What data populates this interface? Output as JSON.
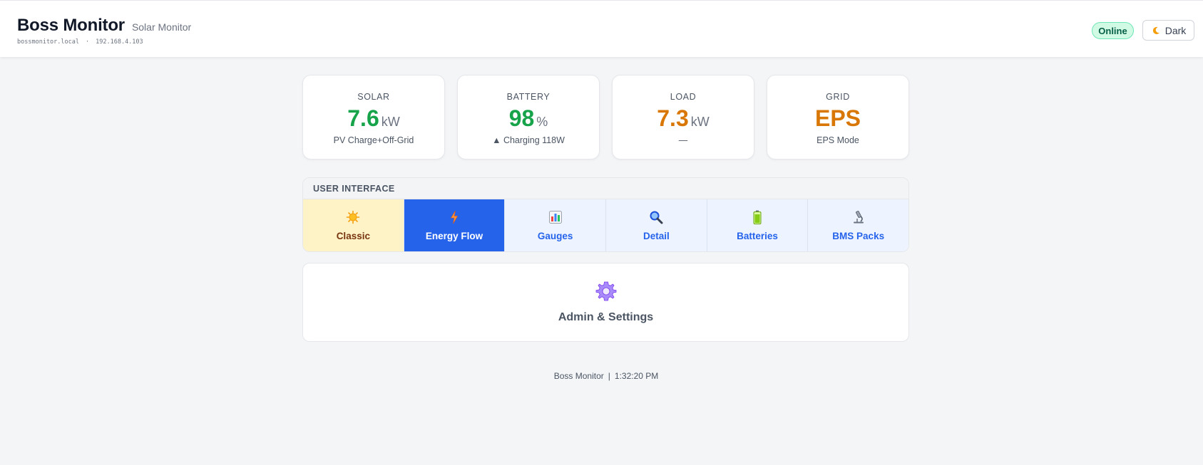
{
  "header": {
    "title": "Boss Monitor",
    "subtitle": "Solar Monitor",
    "hostname": "bossmonitor.local",
    "separator": "·",
    "ip": "192.168.4.103",
    "status": "Online",
    "theme_button_label": "Dark",
    "theme_icon": "moon-icon"
  },
  "stats": {
    "solar": {
      "label": "SOLAR",
      "value": "7.6",
      "unit": "kW",
      "sub": "PV Charge+Off-Grid",
      "color": "#16a34a"
    },
    "battery": {
      "label": "BATTERY",
      "value": "98",
      "unit": "%",
      "sub": "▲ Charging 118W",
      "color": "#16a34a"
    },
    "load": {
      "label": "LOAD",
      "value": "7.3",
      "unit": "kW",
      "sub": "—",
      "color": "#d97706"
    },
    "grid": {
      "label": "GRID",
      "value": "EPS",
      "unit": "",
      "sub": "EPS Mode",
      "color": "#d97706"
    }
  },
  "ui_panel": {
    "title": "USER INTERFACE",
    "tabs": [
      {
        "label": "Classic",
        "icon": "sun-icon"
      },
      {
        "label": "Energy Flow",
        "icon": "lightning-icon"
      },
      {
        "label": "Gauges",
        "icon": "bar-chart-icon"
      },
      {
        "label": "Detail",
        "icon": "magnifier-icon"
      },
      {
        "label": "Batteries",
        "icon": "battery-icon"
      },
      {
        "label": "BMS Packs",
        "icon": "microscope-icon"
      }
    ],
    "active_tab": "Energy Flow",
    "highlighted_tab": "Classic"
  },
  "admin": {
    "label": "Admin & Settings",
    "icon": "gear-icon"
  },
  "footer": {
    "app_name": "Boss Monitor",
    "separator": "|",
    "time": "1:32:20 PM"
  },
  "colors": {
    "accent": "#2563eb",
    "online": "#065f46",
    "warning": "#d97706",
    "success": "#16a34a"
  }
}
